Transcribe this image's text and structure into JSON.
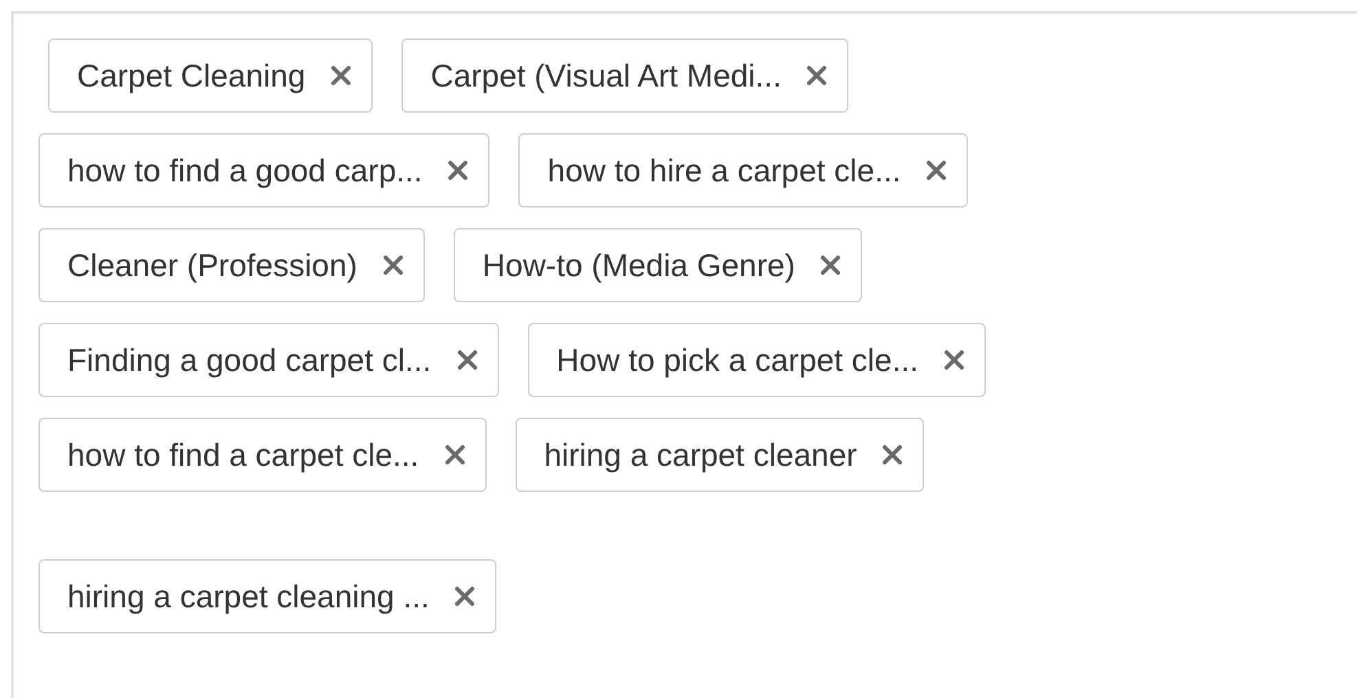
{
  "tag_rows": [
    {
      "tags": [
        {
          "label": "Carpet Cleaning"
        },
        {
          "label": "Carpet (Visual Art Medi..."
        }
      ]
    },
    {
      "tags": [
        {
          "label": "how to find a good carp..."
        },
        {
          "label": "how to hire a carpet cle..."
        }
      ]
    },
    {
      "tags": [
        {
          "label": "Cleaner (Profession)"
        },
        {
          "label": "How-to (Media Genre)"
        }
      ]
    },
    {
      "tags": [
        {
          "label": "Finding a good carpet cl..."
        },
        {
          "label": "How to pick a carpet cle..."
        }
      ]
    },
    {
      "tags": [
        {
          "label": "how to find a carpet cle..."
        },
        {
          "label": "hiring a carpet cleaner"
        }
      ]
    },
    {
      "tags": [
        {
          "label": "hiring a carpet cleaning ..."
        }
      ]
    }
  ]
}
